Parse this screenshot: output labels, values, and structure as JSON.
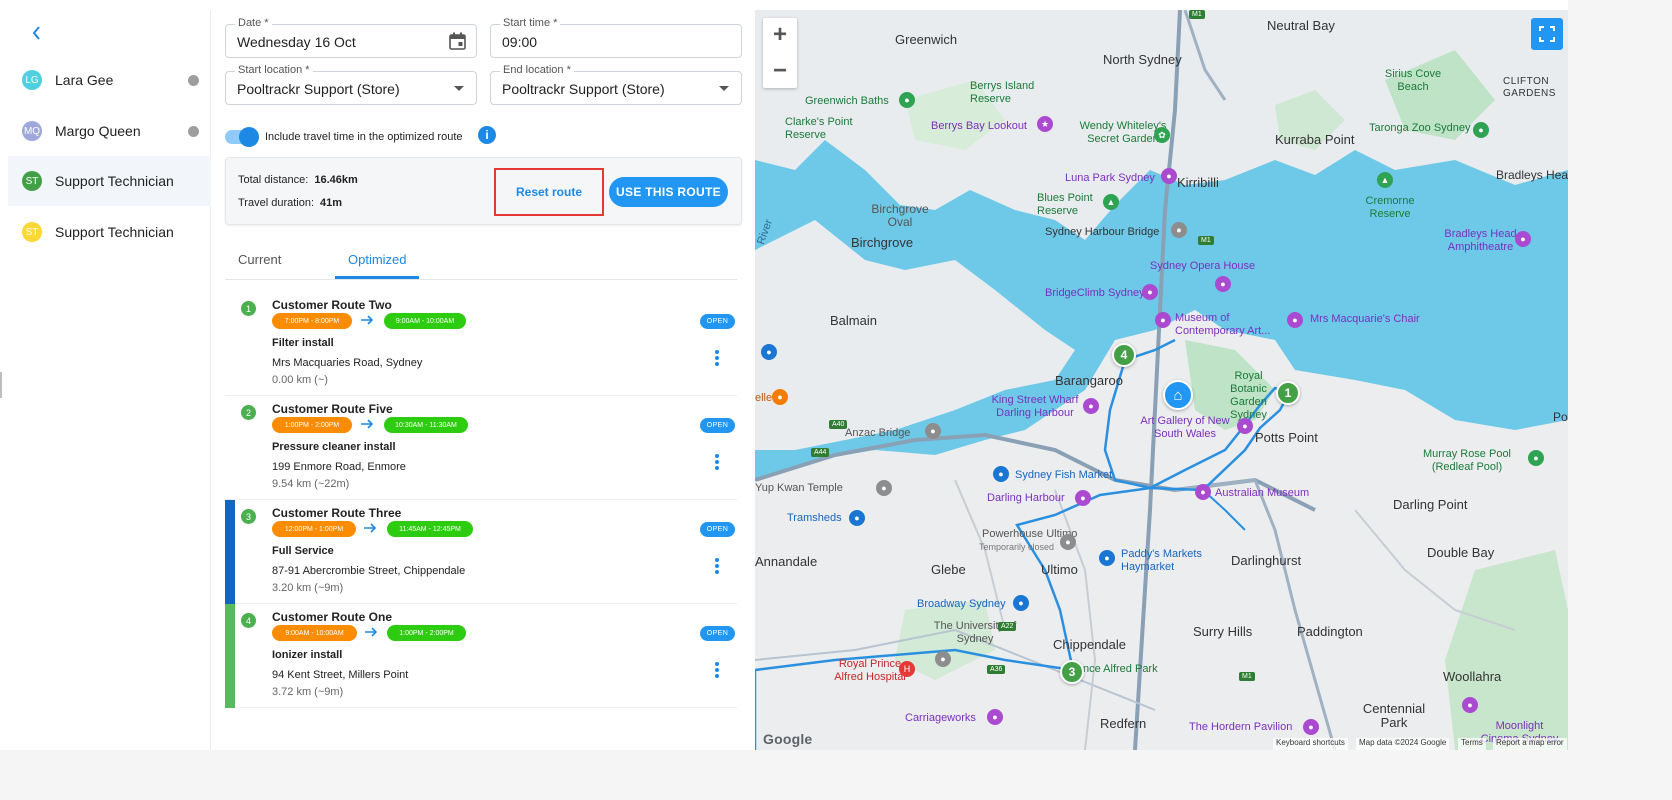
{
  "sidebar": {
    "technicians": [
      {
        "initials": "LG",
        "name": "Lara Gee",
        "color": "#4dd0e1",
        "has_status": true
      },
      {
        "initials": "MQ",
        "name": "Margo Queen",
        "color": "#9fa8da",
        "has_status": true
      },
      {
        "initials": "ST",
        "name": "Support Technician",
        "color": "#43a047",
        "has_status": false
      },
      {
        "initials": "ST",
        "name": "Support Technician",
        "color": "#fdd835",
        "has_status": false
      }
    ]
  },
  "form": {
    "date_label": "Date *",
    "date_value": "Wednesday 16 Oct",
    "start_time_label": "Start time *",
    "start_time_value": "09:00",
    "start_location_label": "Start location *",
    "start_location_value": "Pooltrackr Support (Store)",
    "end_location_label": "End location *",
    "end_location_value": "Pooltrackr Support (Store)",
    "toggle_label": "Include travel time in the optimized route"
  },
  "summary": {
    "distance_label": "Total distance:",
    "distance_value": "16.46km",
    "duration_label": "Travel duration:",
    "duration_value": "41m",
    "reset_label": "Reset route",
    "use_label": "USE THIS ROUTE"
  },
  "tabs": {
    "current": "Current",
    "optimized": "Optimized"
  },
  "routes": [
    {
      "num": "1",
      "title": "Customer Route Two",
      "from": "7:00PM - 8:00PM",
      "to": "9:00AM - 10:00AM",
      "service": "Filter install",
      "address": "Mrs Macquaries Road, Sydney",
      "distance": "0.00 km (~)",
      "status": "OPEN",
      "bar_color": ""
    },
    {
      "num": "2",
      "title": "Customer Route Five",
      "from": "1:00PM - 2:00PM",
      "to": "10:30AM - 11:30AM",
      "service": "Pressure cleaner install",
      "address": "199 Enmore Road, Enmore",
      "distance": "9.54 km (~22m)",
      "status": "OPEN",
      "bar_color": ""
    },
    {
      "num": "3",
      "title": "Customer Route Three",
      "from": "12:00PM - 1:00PM",
      "to": "11:45AM - 12:45PM",
      "service": "Full Service",
      "address": "87-91 Abercrombie Street, Chippendale",
      "distance": "3.20 km (~9m)",
      "status": "OPEN",
      "bar_color": "#1565c0"
    },
    {
      "num": "4",
      "title": "Customer Route One",
      "from": "9:00AM - 10:00AM",
      "to": "1:00PM - 2:00PM",
      "service": "Ionizer install",
      "address": "94 Kent Street, Millers Point",
      "distance": "3.72 km (~9m)",
      "status": "OPEN",
      "bar_color": "#5cb85c"
    }
  ],
  "map": {
    "labels": {
      "neutral_bay": "Neutral Bay",
      "greenwich": "Greenwich",
      "north_sydney": "North Sydney",
      "berrys": "Berrys Island Reserve",
      "sirius": "Sirius Cove Beach",
      "clifton": "CLIFTON GARDENS",
      "greenwich_baths": "Greenwich Baths",
      "clarkes": "Clarke's Point Reserve",
      "berrys_bay": "Berrys Bay Lookout",
      "wendy": "Wendy Whiteley's Secret Garden",
      "taronga": "Taronga Zoo Sydney",
      "kurraba": "Kurraba Point",
      "bradleys": "Bradleys Hea",
      "luna": "Luna Park Sydney",
      "kirribilli": "Kirribilli",
      "blues": "Blues Point Reserve",
      "cremorne": "Cremorne Reserve",
      "birchgrove_oval": "Birchgrove Oval",
      "harbour_bridge": "Sydney Harbour Bridge",
      "bradleys_amph": "Bradleys Head Amphitheatre",
      "birchgrove": "Birchgrove",
      "opera": "Sydney Opera House",
      "bridgeclimb": "BridgeClimb Sydney",
      "mca": "Museum of Contemporary Art...",
      "mrs_macq": "Mrs Macquarie's Chair",
      "balmain": "Balmain",
      "barangaroo": "Barangaroo",
      "royal_botanic": "Royal Botanic Garden Sydney",
      "king_street": "King Street Wharf Darling Harbour",
      "art_gallery": "Art Gallery of New South Wales",
      "potts": "Potts Point",
      "anzac": "Anzac Bridge",
      "murray": "Murray Rose Pool (Redleaf Pool)",
      "fish_market": "Sydney Fish Market",
      "wentworth": "Yup Kwan Temple",
      "darling_harbour": "Darling Harbour",
      "australian_museum": "Australian Museum",
      "darling_point": "Darling Point",
      "tramsheds": "Tramsheds",
      "powerhouse": "Powerhouse Ultimo",
      "temp_closed": "Temporarily closed",
      "paddys": "Paddy's Markets Haymarket",
      "darlinghurst": "Darlinghurst",
      "double_bay": "Double Bay",
      "glebe": "Glebe",
      "ultimo": "Ultimo",
      "annandale": "Annandale",
      "broadway": "Broadway Sydney",
      "surry_hills": "Surry Hills",
      "paddington": "Paddington",
      "uni_sydney": "The University of Sydney",
      "chippendale": "Chippendale",
      "prince_alfred": "nce Alfred Park",
      "royal_prince": "Royal Prince Alfred Hospital",
      "woollahra": "Woollahra",
      "carriageworks": "Carriageworks",
      "redfern": "Redfern",
      "hordern": "The Hordern Pavilion",
      "centennial": "Centennial Park",
      "moonlight": "Moonlight Cinema Sydney",
      "po": "Po",
      "elle": "elle",
      "river": "River"
    },
    "attribution": {
      "google": "Google",
      "shortcuts": "Keyboard shortcuts",
      "data": "Map data ©2024 Google",
      "terms": "Terms",
      "report": "Report a map error"
    },
    "stops": [
      "1",
      "4",
      "3"
    ]
  }
}
